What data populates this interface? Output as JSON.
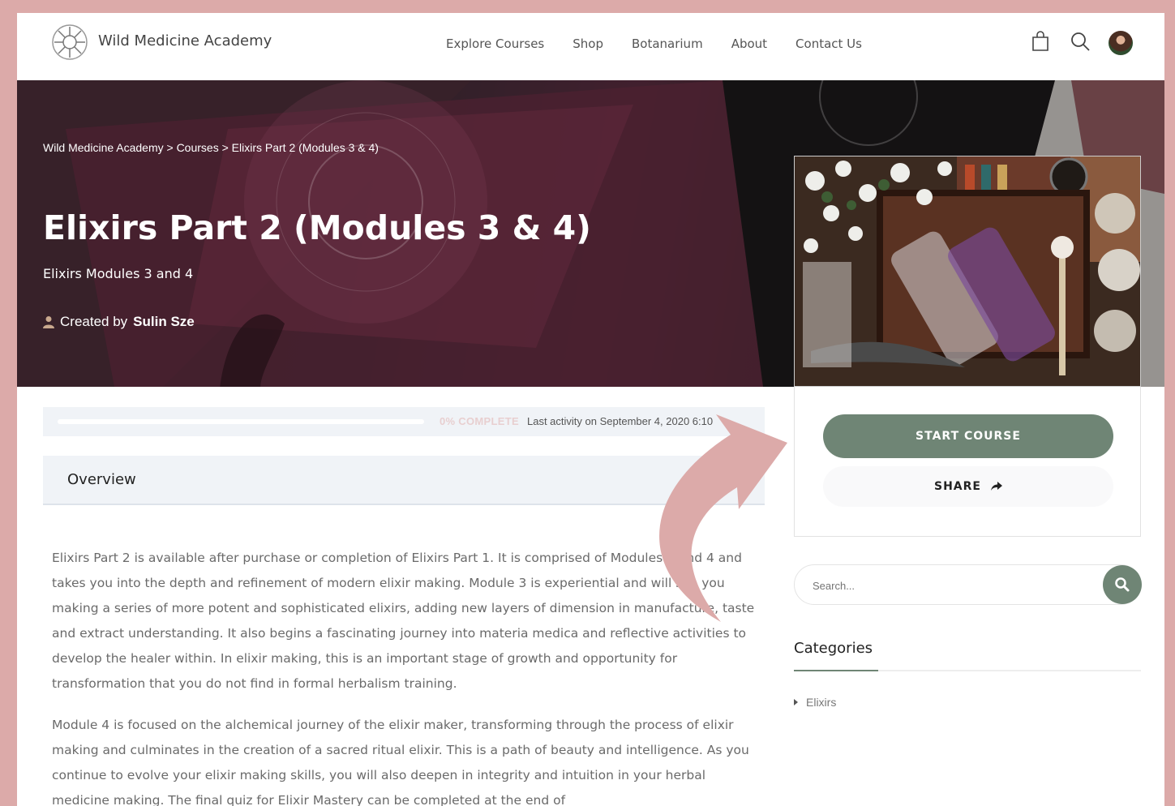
{
  "header": {
    "brand": "Wild Medicine Academy",
    "nav": [
      "Explore Courses",
      "Shop",
      "Botanarium",
      "About",
      "Contact Us"
    ],
    "icons": [
      "shopping-bag-icon",
      "search-icon",
      "avatar"
    ]
  },
  "hero": {
    "breadcrumb": "Wild Medicine Academy > Courses > Elixirs Part 2 (Modules 3 & 4)",
    "title": "Elixirs Part 2 (Modules 3 & 4)",
    "subtitle": "Elixirs Modules 3 and 4",
    "created_by_prefix": "Created by",
    "author": "Sulin Sze"
  },
  "progress": {
    "percent": 0,
    "label": "0% COMPLETE",
    "activity": "Last activity on September 4, 2020 6:10"
  },
  "tabs": {
    "overview": "Overview"
  },
  "sidebar": {
    "start_label": "START COURSE",
    "share_label": "SHARE",
    "search_placeholder": "Search...",
    "categories_title": "Categories",
    "categories": [
      "Elixirs"
    ]
  },
  "content": {
    "paragraphs": [
      "Elixirs Part 2 is available after purchase or completion of Elixirs Part 1. It is comprised of Modules 3 and 4 and takes you into the depth and refinement of modern elixir making. Module 3 is experiential and will see you making a series of more potent and sophisticated elixirs, adding new layers of dimension in manufacture, taste and extract understanding. It also begins a fascinating journey into materia medica and reflective activities to develop the healer within. In elixir making, this is an important stage of growth and opportunity for transformation that you do not find in formal herbalism training.",
      "Module 4 is focused on the alchemical journey of the elixir maker, transforming through the process of elixir making and culminates in the creation of a sacred ritual elixir. This is a path of beauty and intelligence. As you continue to evolve your elixir making skills, you will also deepen in integrity and intuition in your herbal medicine making. The final quiz for Elixir Mastery can be completed at the end of"
    ]
  },
  "colors": {
    "page_border": "#dcaaa9",
    "accent": "#6f8575",
    "arrow": "#dcaaa9"
  }
}
